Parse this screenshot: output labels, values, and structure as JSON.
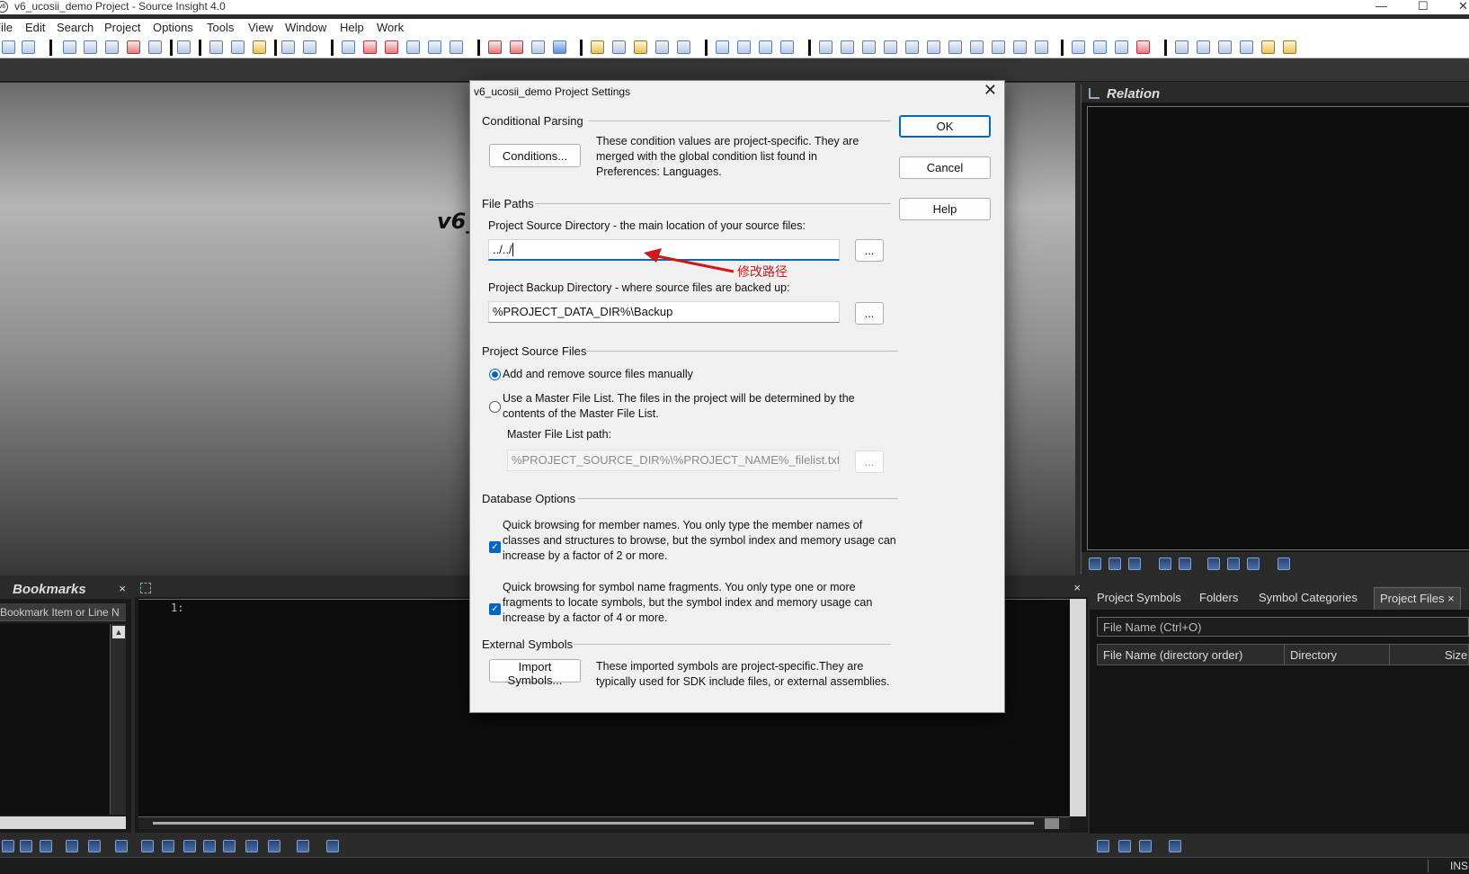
{
  "window": {
    "title": "v6_ucosii_demo Project - Source Insight 4.0",
    "icon_text": "v6"
  },
  "window_controls": {
    "minimize": "—",
    "maximize": "☐",
    "close": "✕"
  },
  "menu": [
    "File",
    "Edit",
    "Search",
    "Project",
    "Options",
    "Tools",
    "View",
    "Window",
    "Help",
    "Work"
  ],
  "main": {
    "watermark_title": "v6_"
  },
  "relation": {
    "title": "Relation"
  },
  "bookmarks": {
    "title": "Bookmarks",
    "close": "×",
    "column": "Bookmark Item or Line N"
  },
  "context": {
    "line_number": "1:",
    "close": "×"
  },
  "project_panel": {
    "tabs": [
      "Project Symbols",
      "Folders",
      "Symbol Categories",
      "Project Files"
    ],
    "active_tab": "Project Files",
    "tab_close": "×",
    "search_placeholder": "File Name (Ctrl+O)",
    "columns": [
      "File Name (directory order)",
      "Directory",
      "Size"
    ]
  },
  "status": {
    "mode": "INS"
  },
  "dialog": {
    "title": "v6_ucosii_demo Project Settings",
    "close": "✕",
    "buttons": {
      "ok": "OK",
      "cancel": "Cancel",
      "help": "Help"
    },
    "conditional_parsing": {
      "heading": "Conditional Parsing",
      "button": "Conditions...",
      "note": "These condition values are project-specific.  They are merged with the global condition list found in Preferences: Languages."
    },
    "file_paths": {
      "heading": "File Paths",
      "source_label": "Project Source Directory - the main location of your source files:",
      "source_value": "../../",
      "backup_label": "Project Backup Directory - where source files are backed up:",
      "backup_value": "%PROJECT_DATA_DIR%\\Backup",
      "browse": "..."
    },
    "project_source_files": {
      "heading": "Project Source Files",
      "option_manual": "Add and remove source files manually",
      "option_master": "Use a Master File List. The files in the project will be determined by the contents of the Master File List.",
      "selected": "manual",
      "master_label": "Master File List path:",
      "master_value": "%PROJECT_SOURCE_DIR%\\%PROJECT_NAME%_filelist.txt"
    },
    "database_options": {
      "heading": "Database Options",
      "member_names": {
        "checked": true,
        "text": "Quick browsing for member names.  You only type the member names of classes and structures to browse, but the symbol index and memory usage can increase by a factor of 2 or more."
      },
      "fragments": {
        "checked": true,
        "text": "Quick browsing for symbol name fragments.  You only type one or more fragments to locate symbols, but the symbol index and memory usage can increase by a factor of 4 or more."
      }
    },
    "external_symbols": {
      "heading": "External Symbols",
      "button": "Import Symbols...",
      "note": "These imported symbols are project-specific.They are typically used for SDK include files, or external assemblies."
    }
  },
  "annotation": {
    "text": "修改路径",
    "color": "#d01818"
  },
  "colors": {
    "accent": "#0067c0",
    "panel_bg": "#141414"
  }
}
